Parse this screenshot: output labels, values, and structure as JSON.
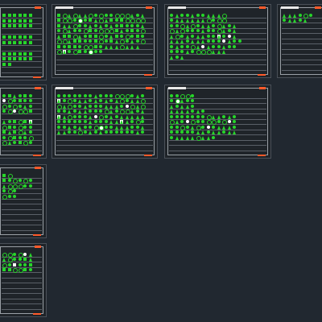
{
  "app": {
    "title": ""
  },
  "colors": {
    "background": "#212830",
    "symbols": "#27d62a",
    "frame": "#9aa0a6",
    "accent": "#ff5a2a",
    "white_symbol": "#ffffff",
    "red_symbol": "#ff2020"
  },
  "sheets": [
    {
      "id": "sheet-1",
      "name": "",
      "symbol_rows": 6
    },
    {
      "id": "sheet-2",
      "name": "",
      "symbol_rows": 5
    },
    {
      "id": "sheet-3",
      "name": "",
      "symbol_rows": 6
    },
    {
      "id": "sheet-4",
      "name": "",
      "symbol_rows": 2
    },
    {
      "id": "sheet-5",
      "name": "",
      "symbol_rows": 6
    },
    {
      "id": "sheet-6",
      "name": "",
      "symbol_rows": 5
    },
    {
      "id": "sheet-7",
      "name": "",
      "symbol_rows": 6
    },
    {
      "id": "sheet-8",
      "name": "",
      "symbol_rows": 3
    },
    {
      "id": "sheet-9",
      "name": "",
      "symbol_rows": 3
    }
  ]
}
